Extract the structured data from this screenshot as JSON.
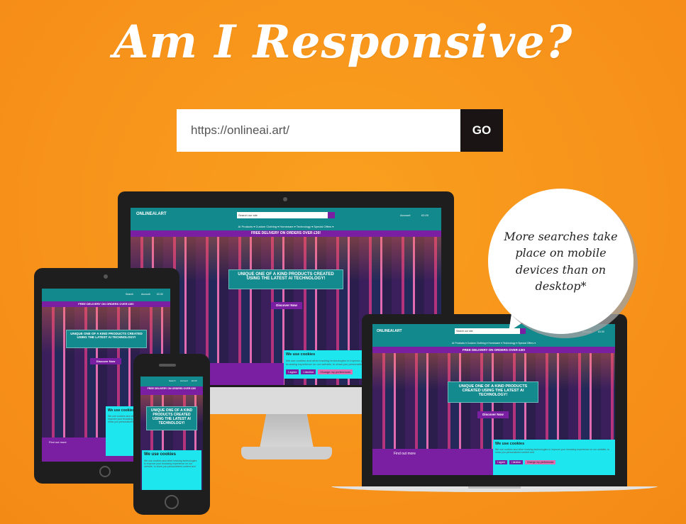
{
  "title": "Am I Responsive?",
  "form": {
    "url_value": "https://onlineai.art/",
    "go_label": "GO"
  },
  "bubble": {
    "text": "More searches take place on mobile devices than on desktop*"
  },
  "site": {
    "logo": "ONLINEAI.ART",
    "search_placeholder": "Search our site",
    "account": "Account",
    "cart": "£0.00",
    "nav": "AI Products ▾   Custom Clothing ▾   Homeware ▾   Technology ▾   Special Offers ▾",
    "promo": "FREE DELIVERY ON ORDERS OVER £30!",
    "hero_text": "UNIQUE ONE OF A KIND PRODUCTS CREATED USING THE LATEST AI TECHNOLOGY!",
    "hero_btn": "Discover Now",
    "find_out": "Find out more",
    "cookie_title": "We use cookies",
    "cookie_body": "We use cookies and other tracking technologies to improve your browsing experience on our website, to show you personalized content and",
    "agree": "I agree",
    "decline": "I decline",
    "change_prefs": "Change my preferences"
  },
  "colors": {
    "background": "#f7921a",
    "teal": "#12898c",
    "purple": "#7b1fa2",
    "cookie": "#1ee6ee"
  }
}
